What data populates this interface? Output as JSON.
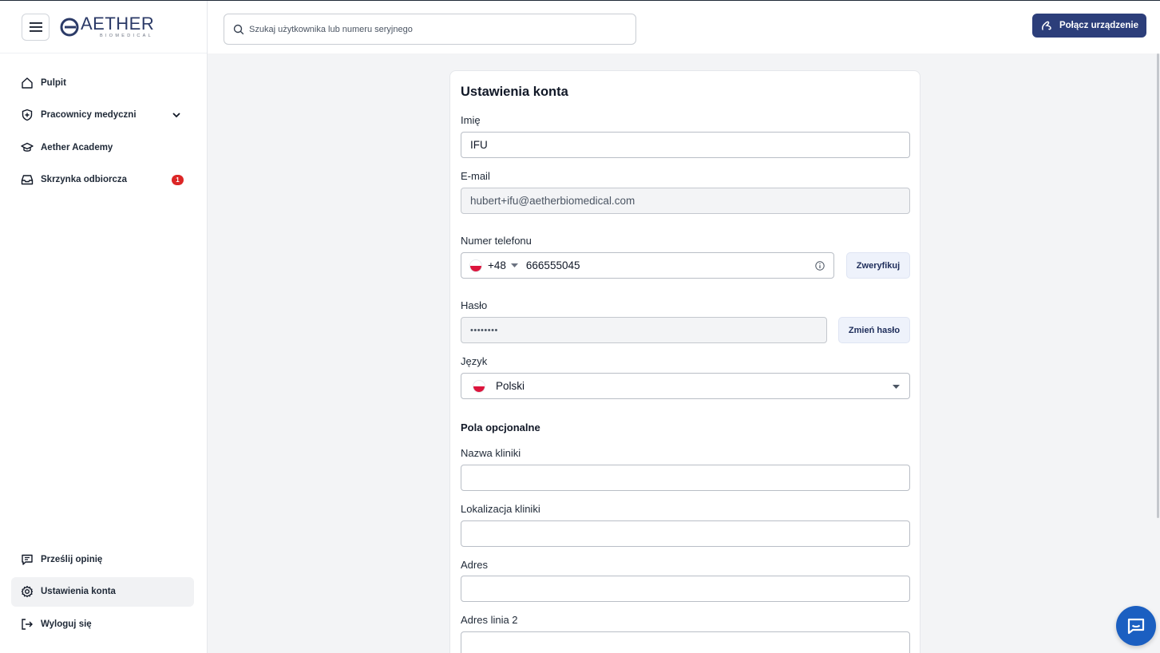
{
  "logo": {
    "main": "AETHER",
    "sub": "BIOMEDICAL"
  },
  "search": {
    "placeholder": "Szukaj użytkownika lub numeru seryjnego"
  },
  "header": {
    "connect_label": "Połącz urządzenie"
  },
  "sidebar": {
    "items": [
      {
        "label": "Pulpit",
        "icon": "home-icon"
      },
      {
        "label": "Pracownicy medyczni",
        "icon": "shield-plus-icon"
      },
      {
        "label": "Aether Academy",
        "icon": "graduation-cap-icon"
      },
      {
        "label": "Skrzynka odbiorcza",
        "icon": "inbox-icon",
        "badge": "1"
      }
    ],
    "bottom_items": [
      {
        "label": "Prześlij opinię",
        "icon": "message-icon"
      },
      {
        "label": "Ustawienia konta",
        "icon": "gear-icon",
        "active": true
      },
      {
        "label": "Wyloguj się",
        "icon": "logout-icon"
      }
    ]
  },
  "form": {
    "title": "Ustawienia konta",
    "name_label": "Imię",
    "name_value": "IFU",
    "email_label": "E-mail",
    "email_value": "hubert+ifu@aetherbiomedical.com",
    "phone_label": "Numer telefonu",
    "phone_code": "+48",
    "phone_value": "666555045",
    "verify_label": "Zweryfikuj",
    "password_label": "Hasło",
    "password_value": "••••••••",
    "change_password_label": "Zmień hasło",
    "language_label": "Język",
    "language_value": "Polski",
    "optional_title": "Pola opcjonalne",
    "clinic_name_label": "Nazwa kliniki",
    "clinic_location_label": "Lokalizacja kliniki",
    "address_label": "Adres",
    "address2_label": "Adres linia 2"
  },
  "colors": {
    "primary": "#2c3e7a",
    "badge": "#dc2626",
    "chat": "#1b5fc1"
  }
}
